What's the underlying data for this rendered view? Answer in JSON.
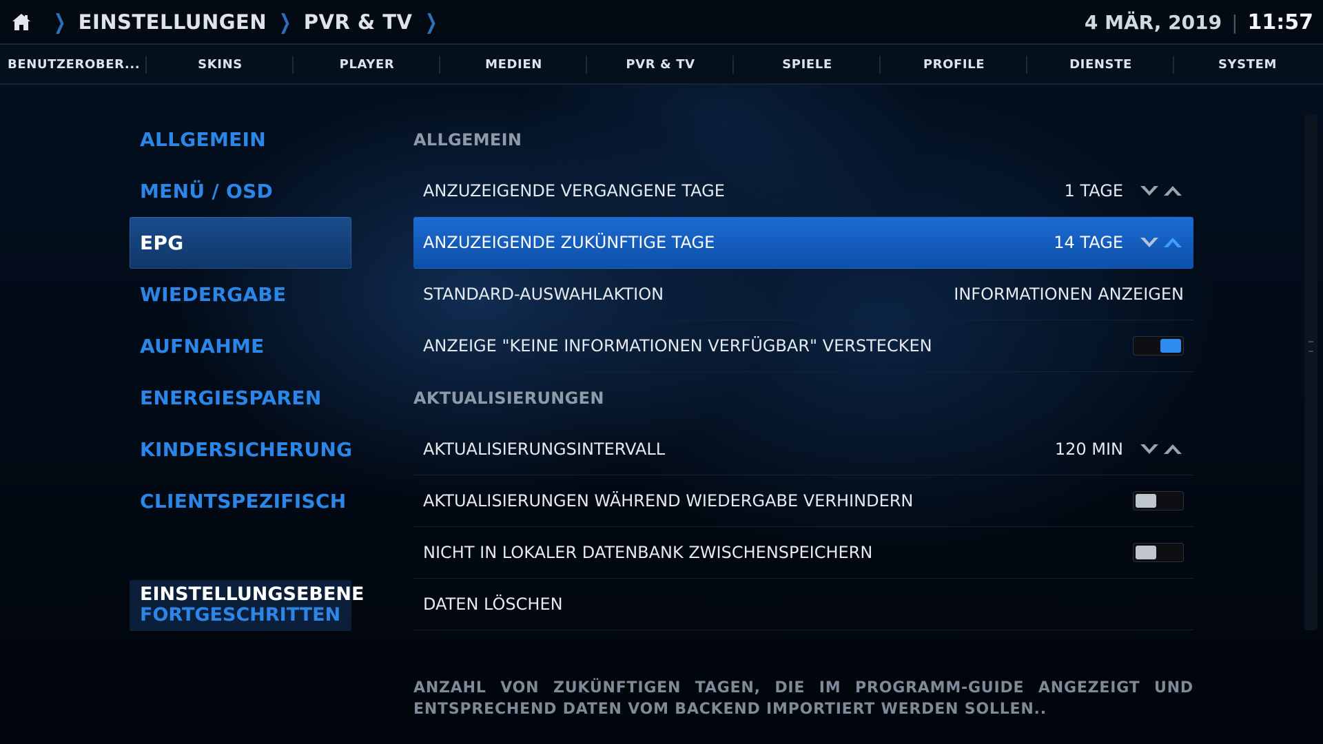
{
  "header": {
    "breadcrumb": [
      "EINSTELLUNGEN",
      "PVR & TV"
    ],
    "date": "4 MÄR, 2019",
    "time": "11:57"
  },
  "tabs": [
    "BENUTZEROBER...",
    "SKINS",
    "PLAYER",
    "MEDIEN",
    "PVR & TV",
    "SPIELE",
    "PROFILE",
    "DIENSTE",
    "SYSTEM"
  ],
  "categories": {
    "items": [
      "ALLGEMEIN",
      "MENÜ / OSD",
      "EPG",
      "WIEDERGABE",
      "AUFNAHME",
      "ENERGIESPAREN",
      "KINDERSICHERUNG",
      "CLIENTSPEZIFISCH"
    ],
    "active_index": 2
  },
  "settings_level": {
    "title": "EINSTELLUNGSEBENE",
    "value": "FORTGESCHRITTEN"
  },
  "settings": {
    "section_general": "ALLGEMEIN",
    "past_days": {
      "label": "ANZUZEIGENDE VERGANGENE TAGE",
      "value": "1 TAGE"
    },
    "future_days": {
      "label": "ANZUZEIGENDE ZUKÜNFTIGE TAGE",
      "value": "14 TAGE"
    },
    "default_action": {
      "label": "STANDARD-AUSWAHLAKTION",
      "value": "INFORMATIONEN ANZEIGEN"
    },
    "hide_no_info": {
      "label": "ANZEIGE \"KEINE INFORMATIONEN VERFÜGBAR\" VERSTECKEN",
      "enabled": true
    },
    "section_updates": "AKTUALISIERUNGEN",
    "update_interval": {
      "label": "AKTUALISIERUNGSINTERVALL",
      "value": "120 MIN"
    },
    "prevent_updates_playback": {
      "label": "AKTUALISIERUNGEN WÄHREND WIEDERGABE VERHINDERN",
      "enabled": false
    },
    "no_local_cache": {
      "label": "NICHT IN LOKALER DATENBANK ZWISCHENSPEICHERN",
      "enabled": false
    },
    "clear_data": {
      "label": "DATEN LÖSCHEN"
    }
  },
  "description": "ANZAHL VON ZUKÜNFTIGEN TAGEN, DIE IM PROGRAMM-GUIDE ANGEZEIGT UND ENTSPRECHEND DATEN VOM BACKEND IMPORTIERT WERDEN SOLLEN..",
  "colors": {
    "accent": "#2b86e8",
    "highlight": "#1565c8",
    "toggle_on": "#2f8cf0"
  },
  "icons": {
    "home": "home-icon",
    "breadcrumb_separator": "chevron-right-icon",
    "spinner_down": "chevron-down-icon",
    "spinner_up": "chevron-up-icon"
  }
}
